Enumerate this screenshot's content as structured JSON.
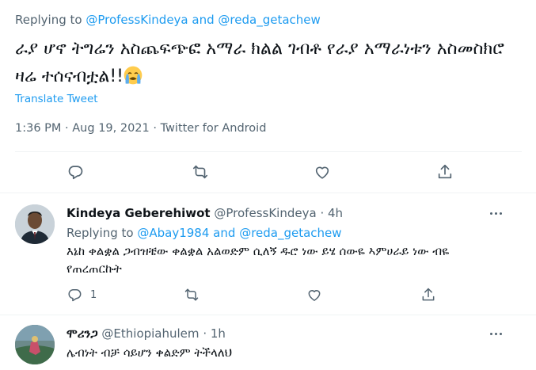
{
  "main_tweet": {
    "replying_prefix": "Replying to",
    "replying_user1": "@ProfessKindeya",
    "replying_and": "and",
    "replying_user2": "@reda_getachew",
    "text": "ራያ ሆኖ ትግሬን አስጨፍጭፎ አማራ ክልል ገብቶ የራያ አማራነቱን አስመስክሮ ዛሬ ተሰናብቷል!!",
    "emoji": "loudly-crying-face-emoji",
    "translate_label": "Translate Tweet",
    "time": "1:36 PM",
    "date": "Aug 19, 2021",
    "source": "Twitter for Android",
    "meta_sep": "·"
  },
  "reply1": {
    "name": "Kindeya Geberehiwot",
    "handle": "@ProfessKindeya",
    "sep": "·",
    "time": "4h",
    "replying_prefix": "Replying to",
    "replying_user1": "@Abay1984",
    "replying_and": "and",
    "replying_user2": "@reda_getachew",
    "text": "እኔከ ቀልቋል ጋብዝቼው ቀልቋል አልወድም ሲለኝ ዱሮ ነው ይሄ ሰውዬ ኣምሀራይ ነው ብዬ የጠረጠርኩት",
    "reply_count": "1"
  },
  "reply2": {
    "name": "ሞሪንጋ",
    "handle": "@Ethiopiahulem",
    "sep": "·",
    "time": "1h",
    "text": "ሌብነት ብቻ ሳይሆን ቀልድም ትችላለህ"
  },
  "colors": {
    "accent": "#1d9bf0",
    "secondary_text": "#536471",
    "primary_text": "#0f1419",
    "divider": "#eff3f4"
  },
  "icons": [
    "reply-icon",
    "retweet-icon",
    "like-icon",
    "share-icon",
    "more-icon"
  ]
}
